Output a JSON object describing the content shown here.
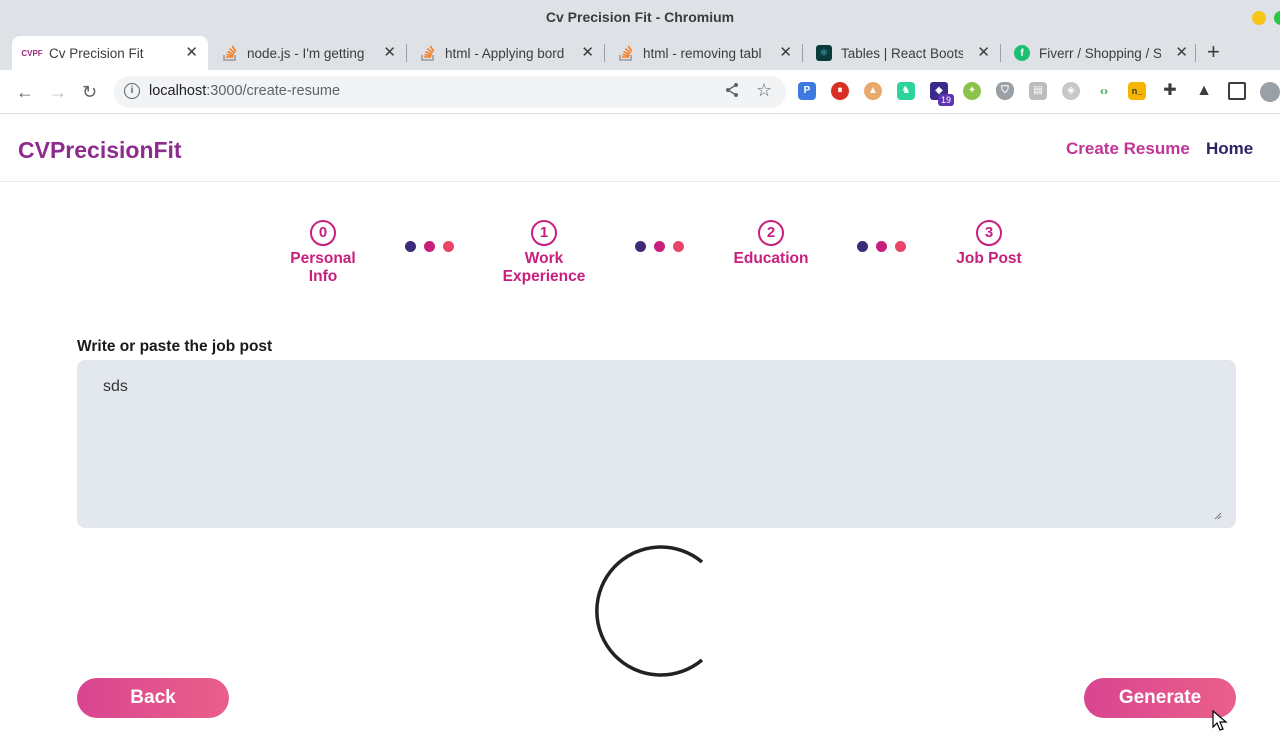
{
  "window": {
    "title": "Cv Precision Fit - Chromium"
  },
  "tabs": [
    {
      "label": "Cv Precision Fit",
      "favicon": "CVPF",
      "active": true
    },
    {
      "label": "node.js - I'm getting",
      "favicon": "stackoverflow-icon"
    },
    {
      "label": "html - Applying bord",
      "favicon": "stackoverflow-icon"
    },
    {
      "label": "html - removing tabl",
      "favicon": "stackoverflow-icon"
    },
    {
      "label": "Tables | React Boots",
      "favicon": "react-bootstrap-icon"
    },
    {
      "label": "Fiverr / Shopping / S",
      "favicon": "fiverr-icon"
    }
  ],
  "omnibox": {
    "host": "localhost",
    "path": ":3000/create-resume"
  },
  "extensions": {
    "badge_count": "19"
  },
  "app": {
    "brand": "CVPrecisionFit",
    "nav": {
      "create": "Create Resume",
      "home": "Home"
    },
    "steps": [
      {
        "number": "0",
        "label_line1": "Personal",
        "label_line2": "Info"
      },
      {
        "number": "1",
        "label_line1": "Work",
        "label_line2": "Experience"
      },
      {
        "number": "2",
        "label_line1": "Education",
        "label_line2": ""
      },
      {
        "number": "3",
        "label_line1": "Job Post",
        "label_line2": ""
      }
    ],
    "job_post": {
      "label": "Write or paste the job post",
      "value": "sds"
    },
    "buttons": {
      "back": "Back",
      "generate": "Generate"
    },
    "colors": {
      "accent": "#c81e7d",
      "brand": "#8e2b8e",
      "dot1": "#3d2a78",
      "dot2": "#c81e7d",
      "dot3": "#e84568"
    }
  }
}
